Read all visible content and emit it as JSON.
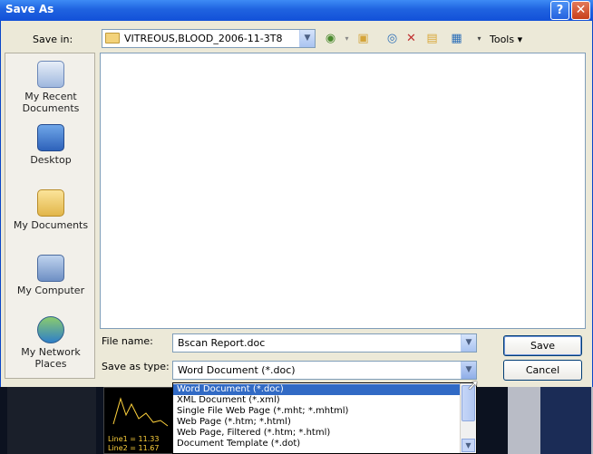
{
  "window": {
    "title": "Save As",
    "help": "?",
    "close": "✕"
  },
  "toolbar": {
    "save_in_label": "Save in:",
    "save_in_value": "VITREOUS,BLOOD_2006-11-3T8",
    "tools_label": "Tools ▾"
  },
  "places": [
    {
      "label": "My Recent Documents",
      "icon": "recent-documents-icon"
    },
    {
      "label": "Desktop",
      "icon": "desktop-icon"
    },
    {
      "label": "My Documents",
      "icon": "my-documents-icon"
    },
    {
      "label": "My Computer",
      "icon": "my-computer-icon"
    },
    {
      "label": "My Network Places",
      "icon": "network-places-icon"
    }
  ],
  "form": {
    "file_name_label": "File name:",
    "file_name_value": "Bscan Report.doc",
    "save_as_type_label": "Save as type:",
    "save_as_type_value": "Word Document (*.doc)",
    "save_button": "Save",
    "cancel_button": "Cancel"
  },
  "type_options": [
    "Word Document (*.doc)",
    "XML Document (*.xml)",
    "Single File Web Page (*.mht; *.mhtml)",
    "Web Page (*.htm; *.html)",
    "Web Page, Filtered (*.htm; *.html)",
    "Document Template (*.dot)"
  ],
  "background_app": {
    "line1": "Line1 = 11.33",
    "line2": "Line2 = 11.67"
  },
  "colors": {
    "titlebar": "#1F63E0",
    "selection": "#316AC5",
    "dialog_bg": "#ECE9D8"
  }
}
